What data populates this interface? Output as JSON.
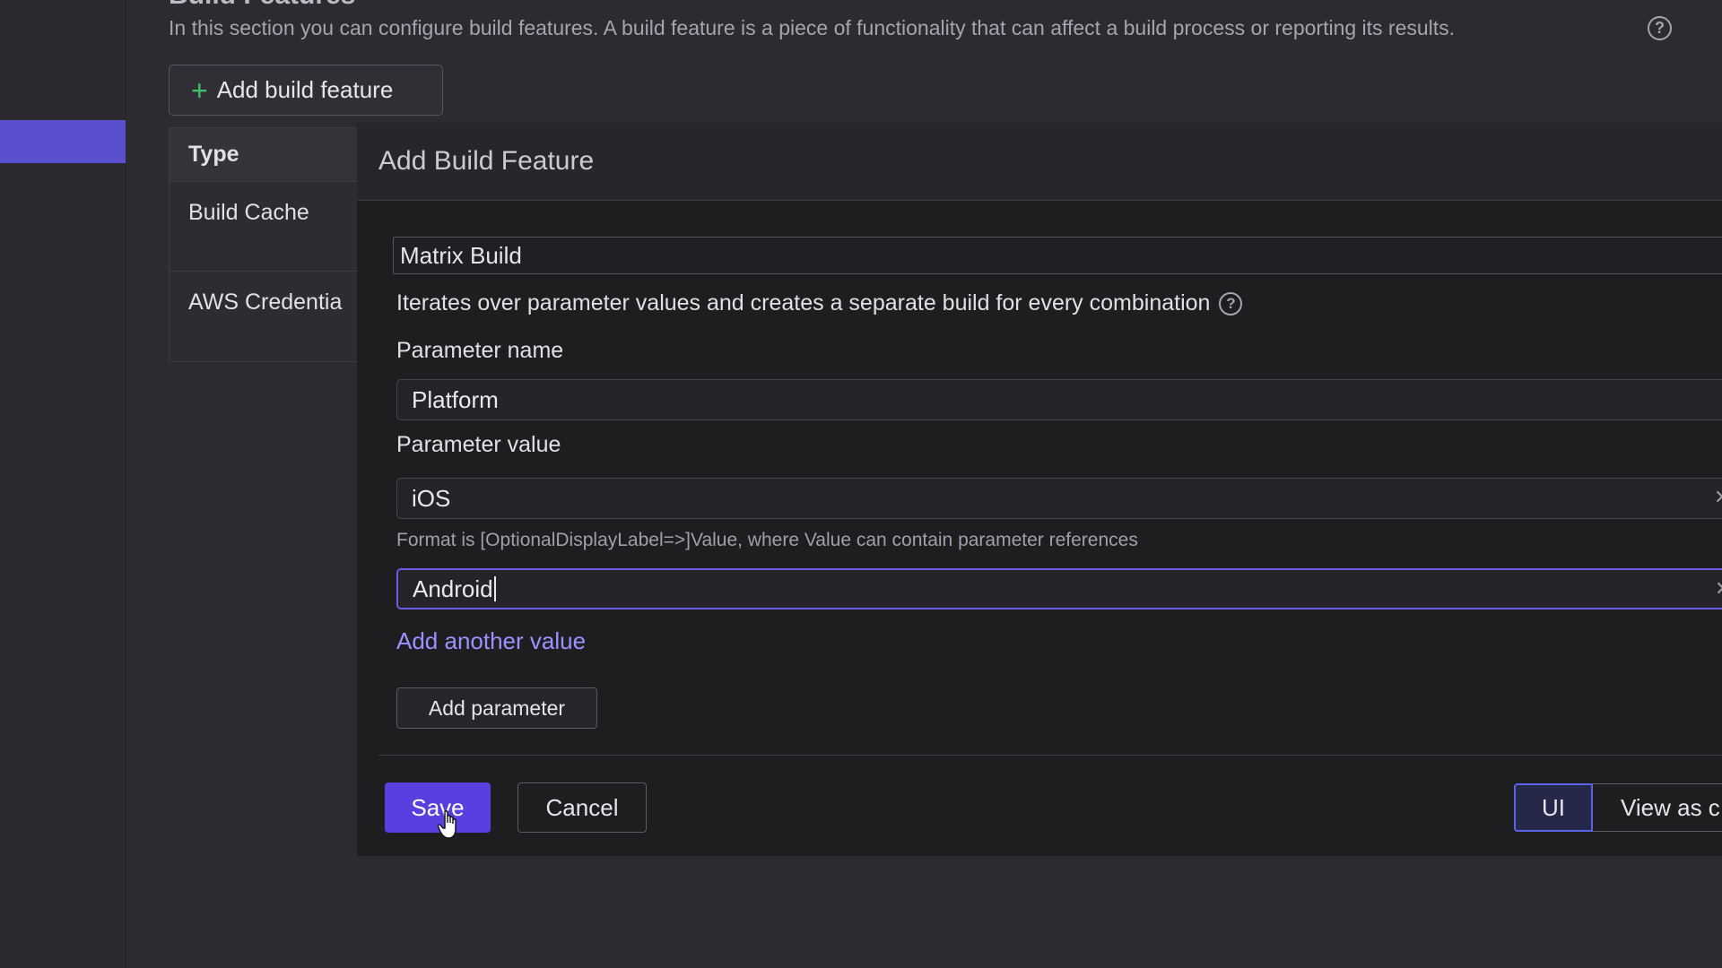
{
  "page": {
    "title": "Build Features",
    "description": "In this section you can configure build features. A build feature is a piece of functionality that can affect a build process or reporting its results.",
    "add_feature_label": "Add build feature"
  },
  "feature_table": {
    "header": "Type",
    "rows": [
      "Build Cache",
      "AWS Credentia"
    ]
  },
  "dialog": {
    "title": "Add Build Feature",
    "feature_type": "Matrix Build",
    "feature_description": "Iterates over parameter values and creates a separate build for every combination",
    "parameter_name_label": "Parameter name",
    "parameter_name_value": "Platform",
    "parameter_value_label": "Parameter value",
    "values": [
      "iOS",
      "Android"
    ],
    "format_hint": "Format is [OptionalDisplayLabel=>]Value, where Value can contain parameter references",
    "add_value_link": "Add another value",
    "add_parameter_label": "Add parameter",
    "save_label": "Save",
    "cancel_label": "Cancel",
    "ui_label": "UI",
    "view_as_label": "View as c"
  },
  "colors": {
    "accent": "#5a3fe0",
    "link": "#9b92ff",
    "plus": "#3fbf6c"
  }
}
